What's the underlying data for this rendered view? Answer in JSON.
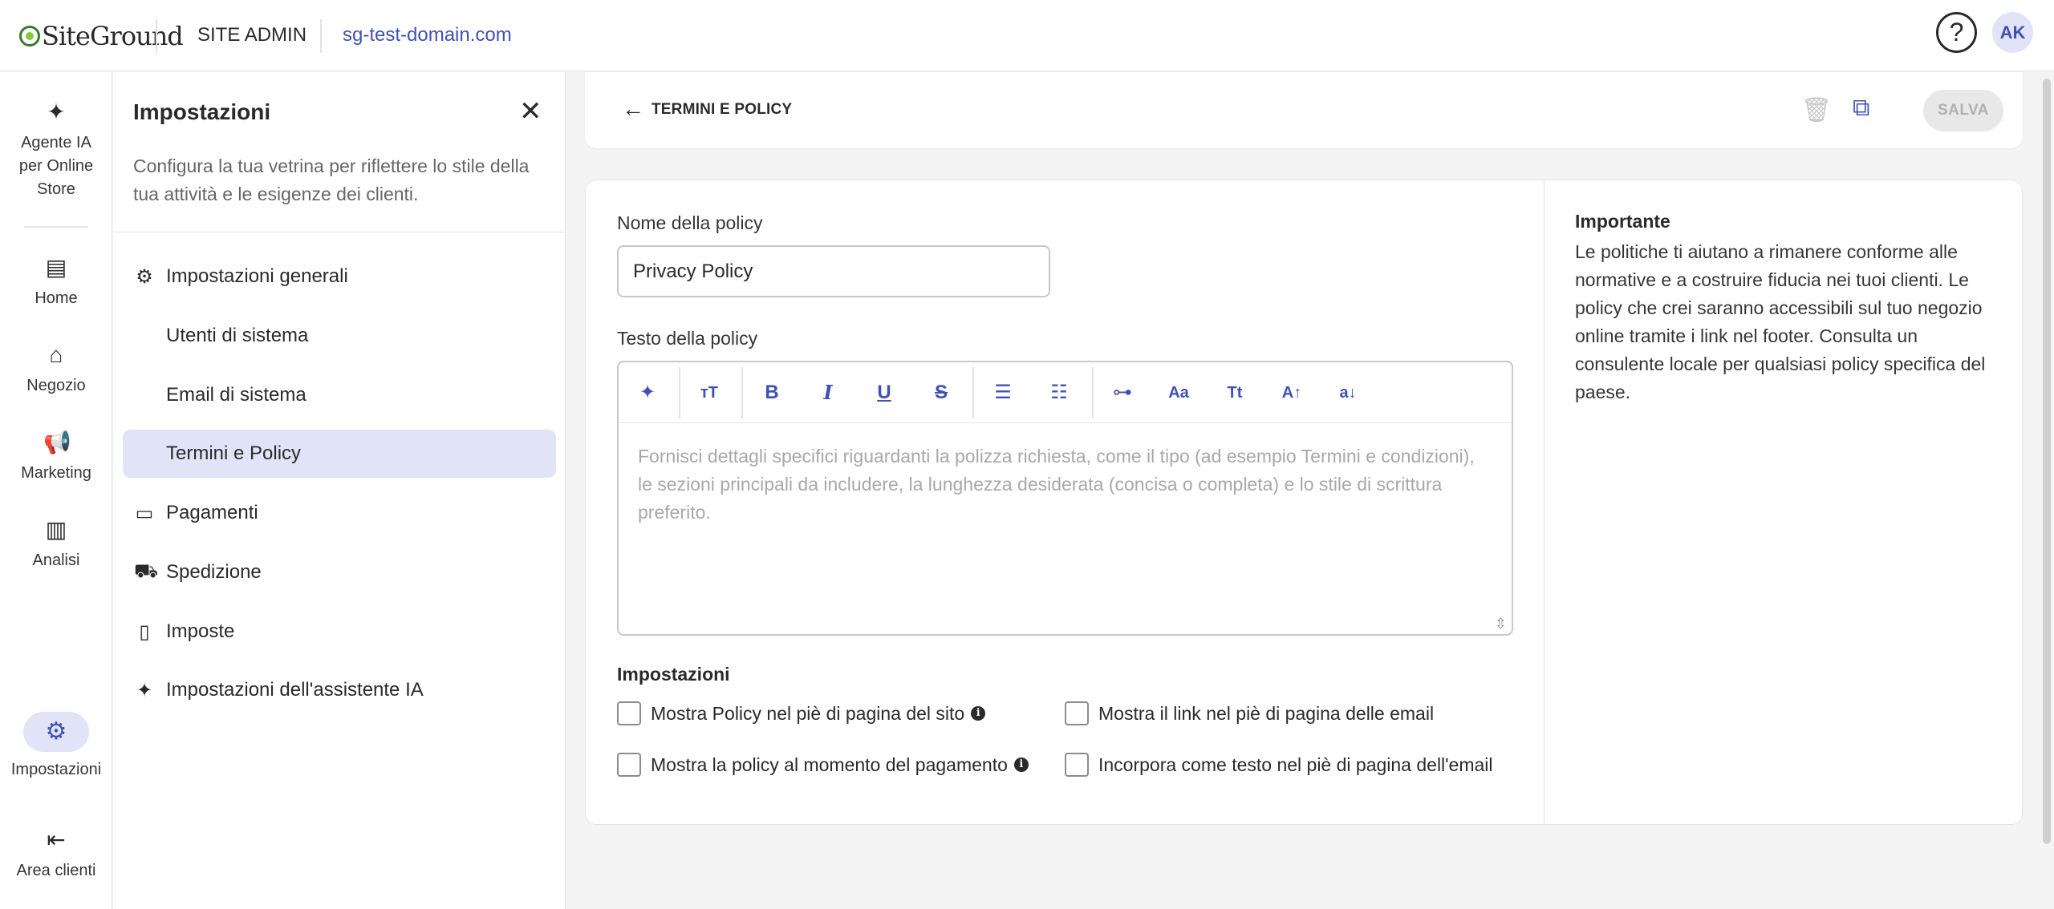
{
  "topbar": {
    "logo_text": "SiteGround",
    "site_admin": "SITE ADMIN",
    "domain": "sg-test-domain.com",
    "help_symbol": "?",
    "avatar_initials": "AK"
  },
  "rail": {
    "items": [
      {
        "label": "Agente IA per Online Store",
        "icon": "sparkle-icon"
      },
      {
        "label": "Home",
        "icon": "home-icon"
      },
      {
        "label": "Negozio",
        "icon": "store-icon"
      },
      {
        "label": "Marketing",
        "icon": "megaphone-icon"
      },
      {
        "label": "Analisi",
        "icon": "chart-icon"
      },
      {
        "label": "Impostazioni",
        "icon": "gear-icon"
      },
      {
        "label": "Area clienti",
        "icon": "exit-icon"
      }
    ]
  },
  "panel": {
    "title": "Impostazioni",
    "description": "Configura la tua vetrina per riflettere lo stile della tua attività e le esigenze dei clienti.",
    "menu": [
      {
        "label": "Impostazioni generali",
        "icon": "gear-icon"
      },
      {
        "label": "Utenti di sistema"
      },
      {
        "label": "Email di sistema"
      },
      {
        "label": "Termini e Policy",
        "active": true
      },
      {
        "label": "Pagamenti",
        "icon": "credit-card-icon"
      },
      {
        "label": "Spedizione",
        "icon": "truck-icon"
      },
      {
        "label": "Imposte",
        "icon": "tax-document-icon"
      },
      {
        "label": "Impostazioni dell'assistente IA",
        "icon": "sparkle-icon"
      }
    ]
  },
  "header": {
    "back_label": "TERMINI E POLICY",
    "save_label": "SALVA"
  },
  "form": {
    "policy_name_label": "Nome della policy",
    "policy_name_value": "Privacy Policy",
    "policy_text_label": "Testo della policy",
    "editor_placeholder": "Fornisci dettagli specifici riguardanti la polizza richiesta, come il tipo (ad esempio Termini e condizioni), le sezioni principali da includere, la lunghezza desiderata (concisa o completa) e lo stile di scrittura preferito.",
    "toolbar": [
      {
        "name": "ai-sparkle-icon",
        "glyph": "✦"
      },
      {
        "name": "text-size-icon",
        "glyph": "тT"
      },
      {
        "name": "bold-icon",
        "glyph": "B"
      },
      {
        "name": "italic-icon",
        "glyph": "I"
      },
      {
        "name": "underline-icon",
        "glyph": "U"
      },
      {
        "name": "strikethrough-icon",
        "glyph": "S"
      },
      {
        "name": "bullet-list-icon",
        "glyph": "☰"
      },
      {
        "name": "numbered-list-icon",
        "glyph": "☷"
      },
      {
        "name": "link-icon",
        "glyph": "⊶"
      },
      {
        "name": "font-icon",
        "glyph": "Aa"
      },
      {
        "name": "title-case-icon",
        "glyph": "Tt"
      },
      {
        "name": "uppercase-icon",
        "glyph": "A↑"
      },
      {
        "name": "lowercase-icon",
        "glyph": "a↓"
      }
    ],
    "settings_heading": "Impostazioni",
    "checkboxes": [
      {
        "label": "Mostra Policy nel piè di pagina del sito",
        "info": true
      },
      {
        "label": "Mostra il link nel piè di pagina delle email",
        "info": false
      },
      {
        "label": "Mostra la policy al momento del pagamento",
        "info": true
      },
      {
        "label": "Incorpora come testo nel piè di pagina dell'email",
        "info": false
      }
    ]
  },
  "sidebar_note": {
    "title": "Importante",
    "text": "Le politiche ti aiutano a rimanere conforme alle normative e a costruire fiducia nei tuoi clienti. Le policy che crei saranno accessibili sul tuo negozio online tramite i link nel footer. Consulta un consulente locale per qualsiasi policy specifica del paese."
  },
  "colors": {
    "accent": "#3f51b5",
    "active_bg": "#e1e4f7",
    "disabled_button": "#e8e8e8"
  }
}
